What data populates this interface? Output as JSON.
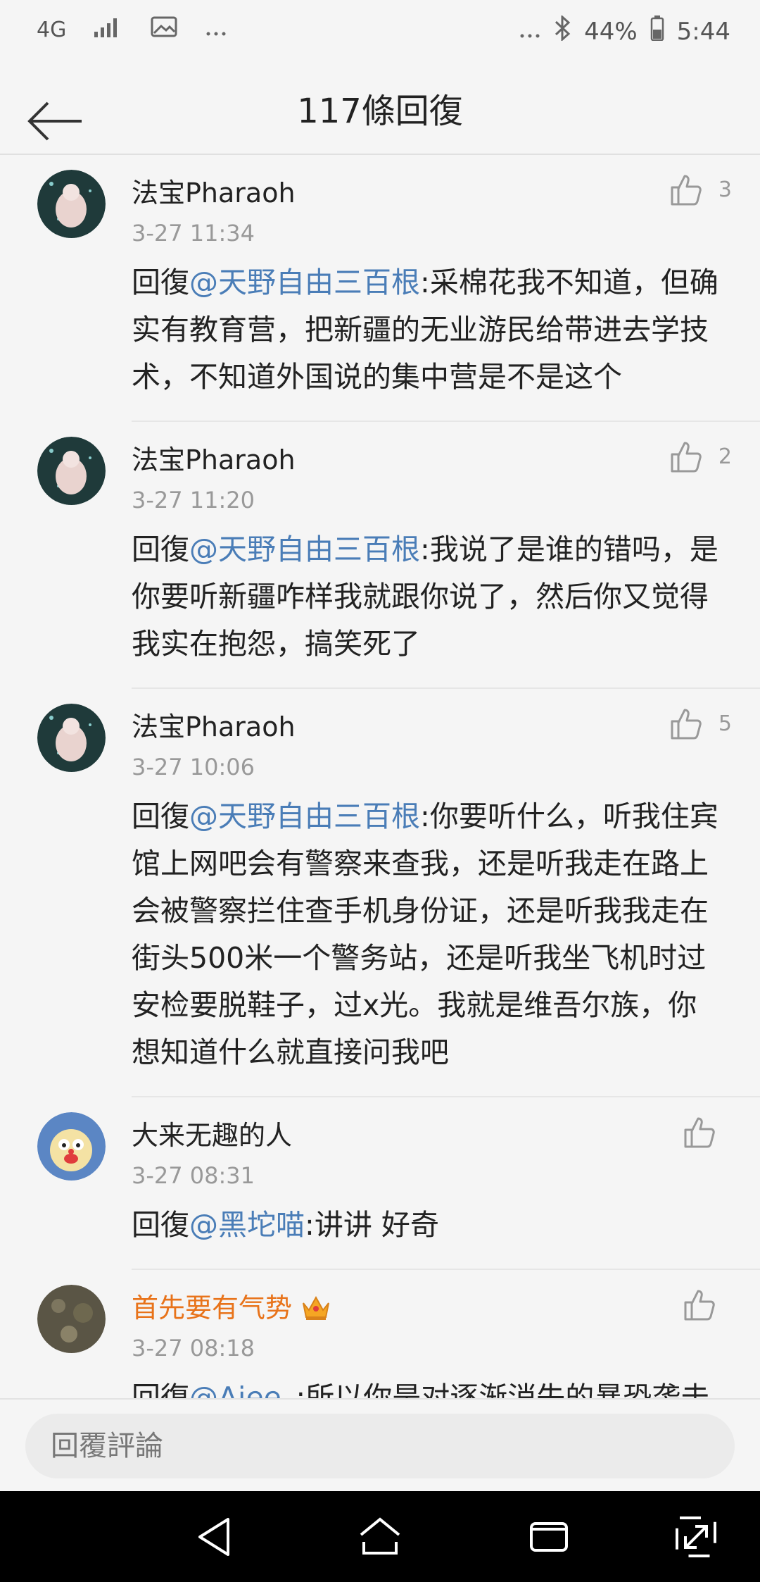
{
  "status_bar": {
    "network": "4G",
    "battery": "44%",
    "time": "5:44",
    "icons": [
      "signal-icon",
      "image-icon",
      "more-icon",
      "bluetooth-icon",
      "battery-icon"
    ]
  },
  "header": {
    "title": "117條回復"
  },
  "comments": [
    {
      "name": "法宝Pharaoh",
      "time": "3-27 11:34",
      "likes": "3",
      "prefix": "回復",
      "mention": "@天野自由三百根",
      "text": ":采棉花我不知道，但确实有教育营，把新疆的无业游民给带进去学技术，不知道外国说的集中营是不是这个"
    },
    {
      "name": "法宝Pharaoh",
      "time": "3-27 11:20",
      "likes": "2",
      "prefix": "回復",
      "mention": "@天野自由三百根",
      "text": ":我说了是谁的错吗，是你要听新疆咋样我就跟你说了，然后你又觉得我实在抱怨，搞笑死了"
    },
    {
      "name": "法宝Pharaoh",
      "time": "3-27 10:06",
      "likes": "5",
      "prefix": "回復",
      "mention": "@天野自由三百根",
      "text": ":你要听什么，听我住宾馆上网吧会有警察来查我，还是听我走在路上会被警察拦住查手机身份证，还是听我我走在街头500米一个警务站，还是听我坐飞机时过安检要脱鞋子，过x光。我就是维吾尔族，你想知道什么就直接问我吧"
    },
    {
      "name": "大来无趣的人",
      "time": "3-27 08:31",
      "likes": "",
      "prefix": "回復",
      "mention": "@黑坨喵",
      "text": ":讲讲 好奇"
    },
    {
      "name": "首先要有气势",
      "time": "3-27 08:18",
      "likes": "",
      "prefix": "回復",
      "mention": "@Ajee_",
      "text": ":所以你是对逐渐消失的暴恐袭击"
    }
  ],
  "reply_bar": {
    "placeholder": "回覆評論"
  },
  "colors": {
    "mention": "#4a7db7",
    "vip_name": "#e8731a",
    "meta": "#999999"
  }
}
